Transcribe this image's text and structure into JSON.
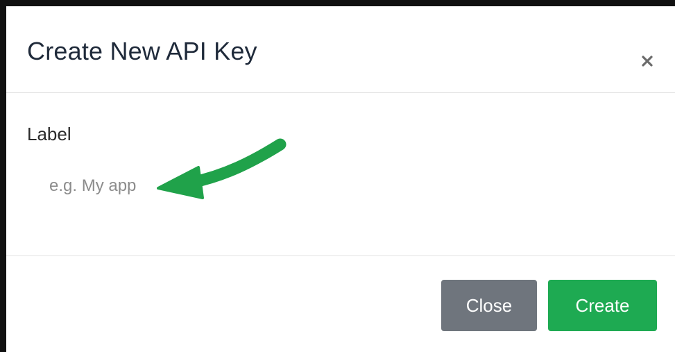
{
  "modal": {
    "title": "Create New API Key",
    "close_icon": "close-x-icon"
  },
  "form": {
    "label": "Label",
    "input_value": "",
    "input_placeholder": "e.g. My app"
  },
  "annotation": {
    "icon": "arrow-pointer-icon",
    "color": "#20a24a"
  },
  "footer": {
    "close_label": "Close",
    "create_label": "Create"
  },
  "colors": {
    "close_button": "#6f757d",
    "create_button": "#1eaa52",
    "frame_border": "#111111"
  }
}
